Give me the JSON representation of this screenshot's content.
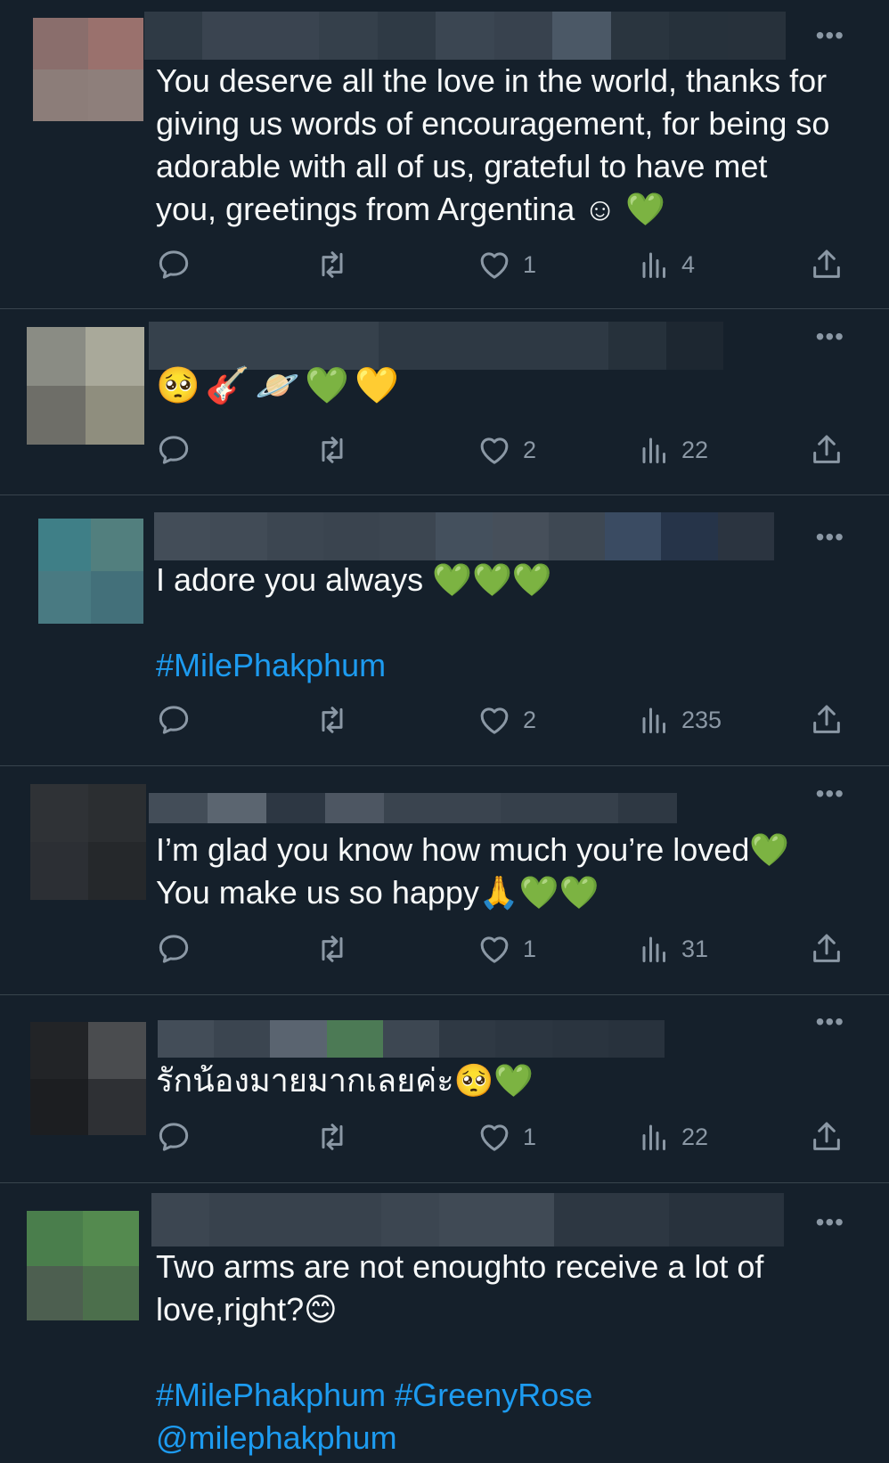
{
  "tweets": [
    {
      "text": "You deserve all the love in the world, thanks for giving us words of encouragement, for being so adorable with all of us, grateful to have met you, greetings from Argentina ☺ 💚",
      "likes": "1",
      "views": "4",
      "hashtags": ""
    },
    {
      "text": "🥺🎸🪐💚💛",
      "likes": "2",
      "views": "22",
      "hashtags": ""
    },
    {
      "text": "I adore you always 💚💚💚",
      "likes": "2",
      "views": "235",
      "hashtags": "#MilePhakphum"
    },
    {
      "text": "I’m glad you know how much you’re loved💚\nYou make us so happy🙏💚💚",
      "likes": "1",
      "views": "31",
      "hashtags": ""
    },
    {
      "text": "รักน้องมายมากเลยค่ะ🥺💚",
      "likes": "1",
      "views": "22",
      "hashtags": ""
    },
    {
      "text": "Two arms are not enoughto receive a lot of love,right?😊",
      "likes": "",
      "views": "",
      "hashtags": "#MilePhakphum #GreenyRose\n@milephakphum"
    }
  ],
  "icons": {
    "reply": "reply-icon",
    "retweet": "retweet-icon",
    "like": "heart-icon",
    "views": "views-icon",
    "share": "share-icon",
    "more": "more-icon"
  },
  "more_glyph": "•••",
  "colors": {
    "background": "#15202b",
    "text": "#f7f9f9",
    "muted": "#8b98a5",
    "link": "#1d9bf0",
    "divider": "#38444d"
  }
}
